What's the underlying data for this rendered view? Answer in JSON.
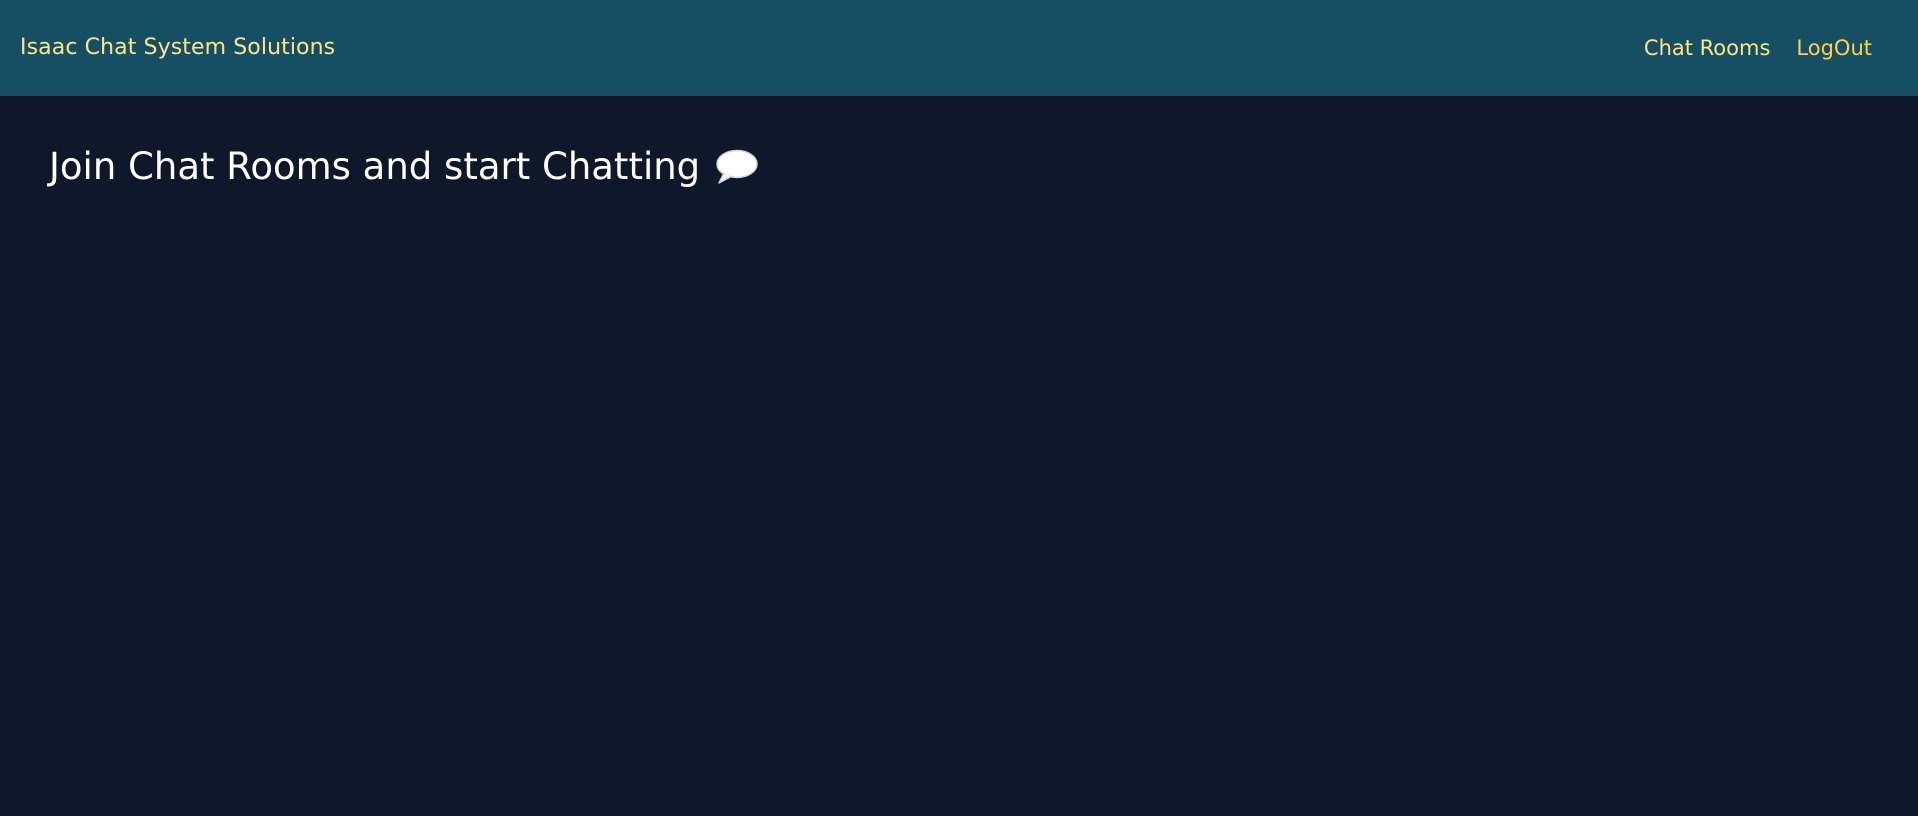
{
  "navbar": {
    "brand": "Isaac Chat System Solutions",
    "links": [
      {
        "label": "Chat Rooms"
      },
      {
        "label": "LogOut"
      }
    ]
  },
  "main": {
    "heading": "Join Chat Rooms and start Chatting",
    "heading_icon": "speech-bubble-icon"
  },
  "colors": {
    "navbar_bg": "#164e63",
    "page_bg": "#0f172a",
    "nav_text": "#fde68a",
    "heading_text": "#ffffff"
  }
}
